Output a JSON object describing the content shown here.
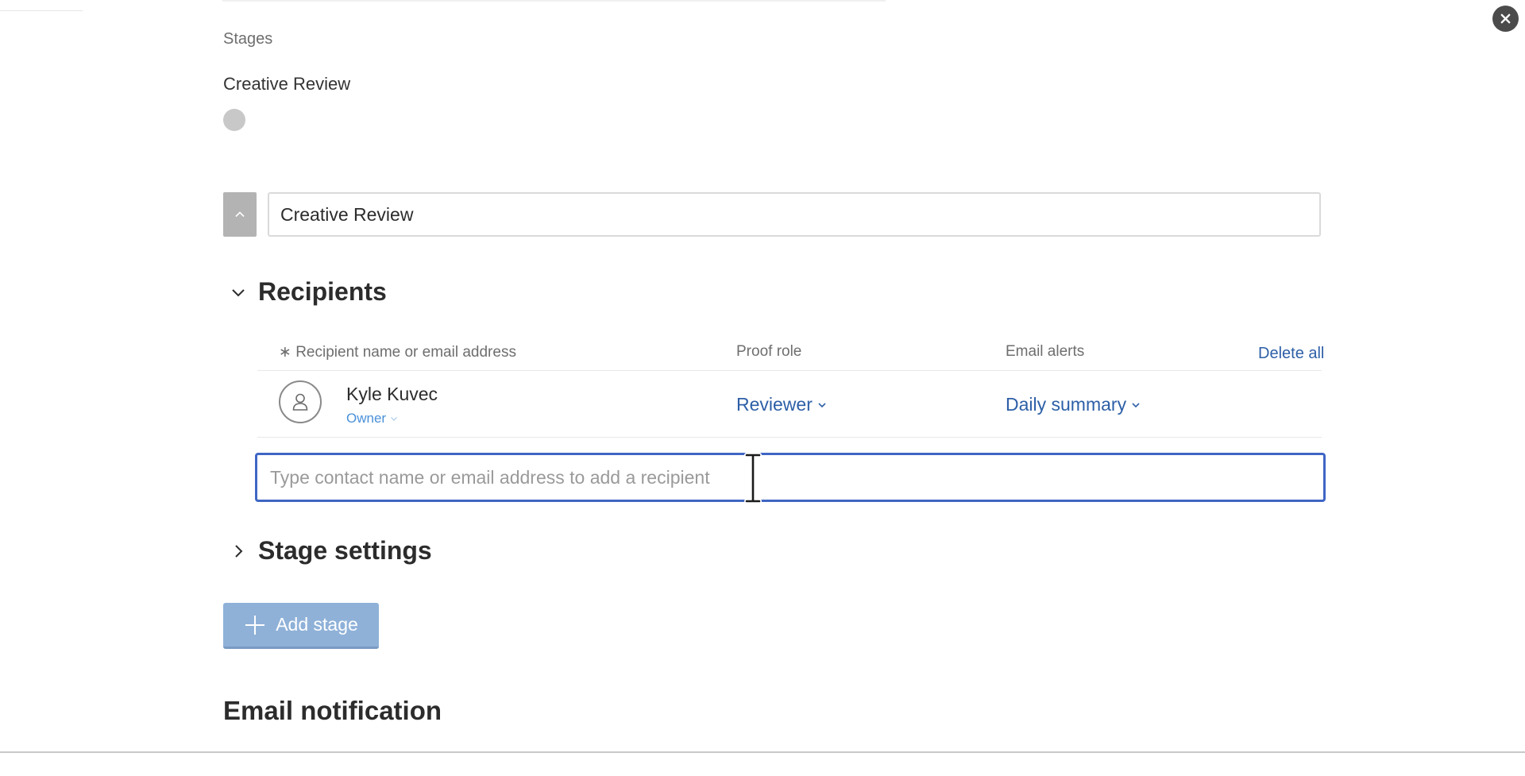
{
  "header": {
    "close_icon": "close-icon"
  },
  "stages": {
    "label": "Stages",
    "current_stage_title": "Creative Review",
    "stage_name_value": "Creative Review",
    "stage_dot_color": "#c8c8c8"
  },
  "recipients": {
    "title": "Recipients",
    "columns": {
      "recipient": "∗ Recipient name or email address",
      "proof_role": "Proof role",
      "email_alerts": "Email alerts"
    },
    "delete_all_label": "Delete all",
    "rows": [
      {
        "name": "Kyle Kuvec",
        "sublabel": "Owner",
        "proof_role": "Reviewer",
        "email_alert": "Daily summary"
      }
    ],
    "add_input_placeholder": "Type contact name or email address to add a recipient"
  },
  "stage_settings": {
    "title": "Stage settings"
  },
  "actions": {
    "add_stage_label": "Add stage"
  },
  "email_notification": {
    "title": "Email notification"
  },
  "colors": {
    "link_blue": "#2d5fa7",
    "owner_blue": "#4a90d9",
    "focus_border": "#3f66c4",
    "add_stage_bg": "#8fb1d8"
  }
}
